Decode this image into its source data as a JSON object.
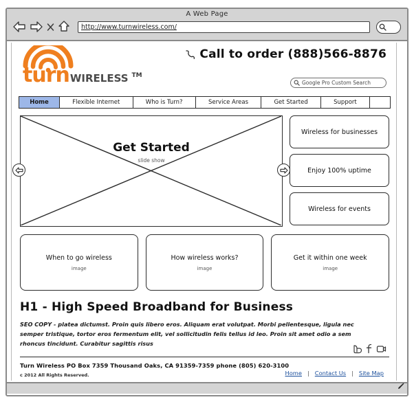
{
  "browser": {
    "window_title": "A Web Page",
    "url": "http://www.turnwireless.com/",
    "icons": {
      "back": "back-arrow-icon",
      "forward": "forward-arrow-icon",
      "stop": "close-x-icon",
      "home": "home-icon",
      "search": "search-icon"
    }
  },
  "site": {
    "logo": {
      "word_primary": "turn",
      "word_secondary": "WIRELESS",
      "trademark": "TM"
    },
    "call_to_order": "Call to order (888)566-8876",
    "search_placeholder": "Google Pro Custom Search"
  },
  "nav": {
    "items": [
      {
        "label": "Home",
        "active": true
      },
      {
        "label": "Flexible Internet",
        "active": false
      },
      {
        "label": "Who is Turn?",
        "active": false
      },
      {
        "label": "Service Areas",
        "active": false
      },
      {
        "label": "Get Started",
        "active": false
      },
      {
        "label": "Support",
        "active": false
      }
    ]
  },
  "hero": {
    "title": "Get Started",
    "caption": "slide show",
    "prev_label": "Previous slide",
    "next_label": "Next slide"
  },
  "side_boxes": [
    {
      "label": "Wireless for businesses"
    },
    {
      "label": "Enjoy 100% uptime"
    },
    {
      "label": "Wireless for events"
    }
  ],
  "cards": [
    {
      "title": "When to go wireless",
      "caption": "image"
    },
    {
      "title": "How wireless works?",
      "caption": "image"
    },
    {
      "title": "Get it within one week",
      "caption": "image"
    }
  ],
  "seo_section": {
    "heading": "H1 - High Speed Broadband for Business",
    "body": "SEO COPY - platea dictumst. Proin quis libero eros. Aliquam erat volutpat. Morbi pellentesque, ligula nec semper tristique, tortor eros fermentum elit, vel sollicitudin felis tellus id leo. Proin sit amet odio a sem rhoncus tincidunt. Curabitur sagittis risus"
  },
  "footer": {
    "address": "Turn Wireless PO Box 7359 Thousand Oaks,  CA  91359-7359  phone (805) 620-3100",
    "copyright": "c 2012 All Rights Reserved.",
    "links": [
      {
        "label": "Home"
      },
      {
        "label": "Contact Us"
      },
      {
        "label": "Site Map"
      }
    ],
    "separator": "|",
    "social": [
      {
        "name": "twitter-icon"
      },
      {
        "name": "facebook-icon"
      },
      {
        "name": "youtube-icon"
      }
    ]
  },
  "colors": {
    "brand_orange": "#ef7f1f",
    "nav_active": "#9db7e8",
    "link_blue": "#1b4f9c",
    "chrome_gray": "#d4d4d4"
  }
}
